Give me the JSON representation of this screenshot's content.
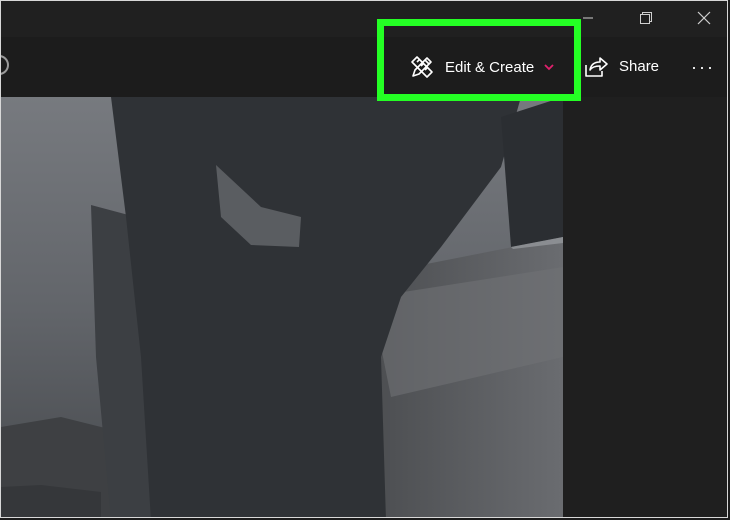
{
  "window": {
    "controls": {
      "minimize_icon": "minimize-icon",
      "restore_icon": "restore-icon",
      "close_icon": "close-icon"
    }
  },
  "toolbar": {
    "edit_create": {
      "label": "Edit & Create",
      "icon": "pencil-ruler-icon",
      "dropdown_icon": "chevron-down-icon",
      "dropdown_color": "#e0206c"
    },
    "share": {
      "label": "Share",
      "icon": "share-icon"
    },
    "more": {
      "label": "···",
      "icon": "more-icon"
    }
  },
  "highlight": {
    "color": "#24ff24"
  },
  "photo": {
    "description_icon": "photo-viewer-image"
  }
}
